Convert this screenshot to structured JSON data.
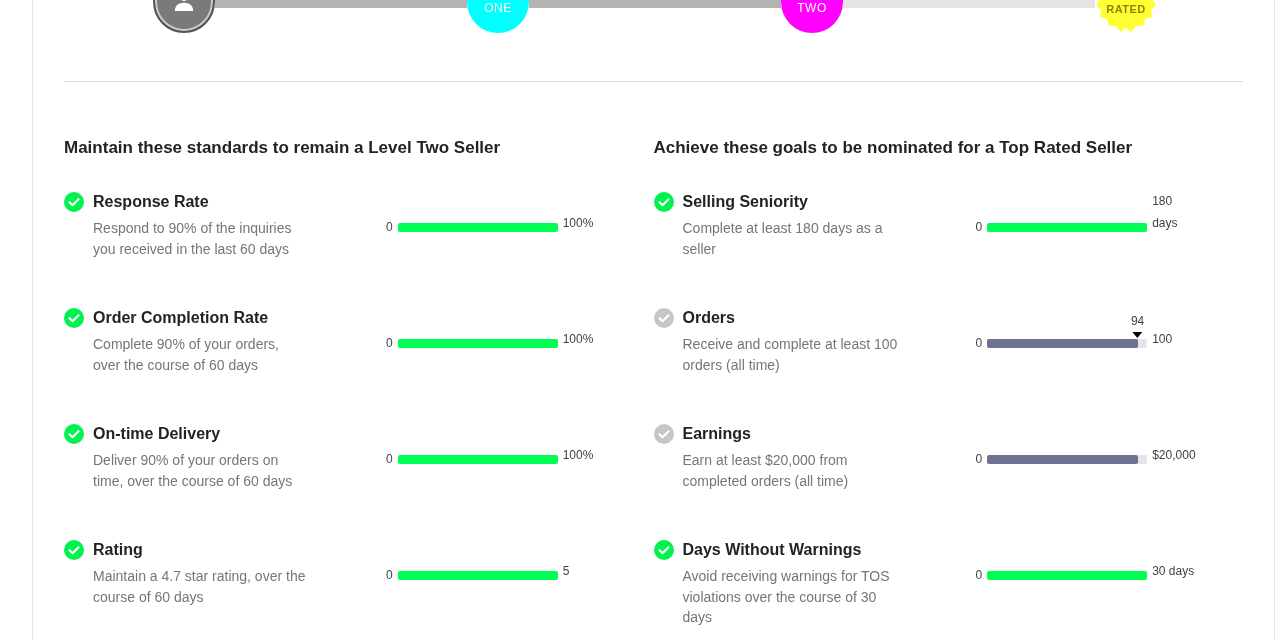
{
  "timeline": {
    "segments": [
      {
        "level": 1
      },
      {
        "level": 1
      },
      {
        "level": 0
      }
    ],
    "badges": [
      {
        "kind": "avatar",
        "color": "#7a7a7a"
      },
      {
        "kind": "circle",
        "label": "ONE",
        "color": "#00ffff"
      },
      {
        "kind": "circle",
        "label": "TWO",
        "color": "#ff00ff"
      },
      {
        "kind": "seal",
        "label": "RATED",
        "color": "#ffff33"
      }
    ]
  },
  "columns": [
    {
      "heading": "Maintain these standards to remain a Level Two Seller",
      "metrics": [
        {
          "title": "Response Rate",
          "description": "Respond to 90% of the inquiries you received in the last 60 days",
          "achieved": true,
          "min": "0",
          "max": "100%",
          "level": 1
        },
        {
          "title": "Order Completion Rate",
          "description": "Complete 90% of your orders, over the course of 60 days",
          "achieved": true,
          "min": "0",
          "max": "100%",
          "level": 1
        },
        {
          "title": "On-time Delivery",
          "description": "Deliver 90% of your orders on time, over the course of 60 days",
          "achieved": true,
          "min": "0",
          "max": "100%",
          "level": 1
        },
        {
          "title": "Rating",
          "description": "Maintain a 4.7 star rating, over the course of 60 days",
          "achieved": true,
          "min": "0",
          "max": "5",
          "level": 1
        }
      ]
    },
    {
      "heading": "Achieve these goals to be nominated for a Top Rated Seller",
      "metrics": [
        {
          "title": "Selling Seniority",
          "description": "Complete at least 180 days as a seller",
          "achieved": true,
          "min": "0",
          "max": "180 days",
          "level": 1
        },
        {
          "title": "Orders",
          "description": "Receive and complete at least 100 orders (all time)",
          "achieved": false,
          "min": "0",
          "max": "100",
          "level": 0.94,
          "marker": "94"
        },
        {
          "title": "Earnings",
          "description": "Earn at least $20,000 from completed orders (all time)",
          "achieved": false,
          "min": "0",
          "max": "$20,000",
          "level": 0.94
        },
        {
          "title": "Days Without Warnings",
          "description": "Avoid receiving warnings for TOS violations over the course of 30 days",
          "achieved": true,
          "min": "0",
          "max": "30 days",
          "level": 1
        }
      ]
    }
  ]
}
